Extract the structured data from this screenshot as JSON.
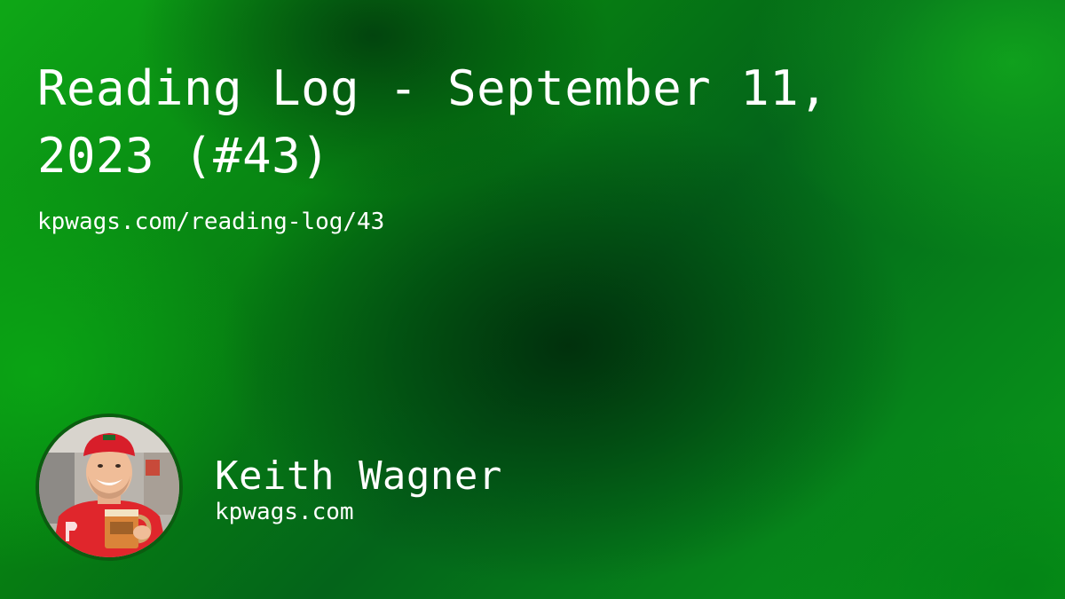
{
  "title": "Reading Log - September 11, 2023 (#43)",
  "url": "kpwags.com/reading-log/43",
  "author": {
    "name": "Keith Wagner",
    "site": "kpwags.com",
    "avatar": "avatar-photo"
  },
  "colors": {
    "background_primary": "#078a14",
    "background_dark": "#04501a",
    "text": "#ffffff",
    "avatar_border": "#0b5c10"
  }
}
